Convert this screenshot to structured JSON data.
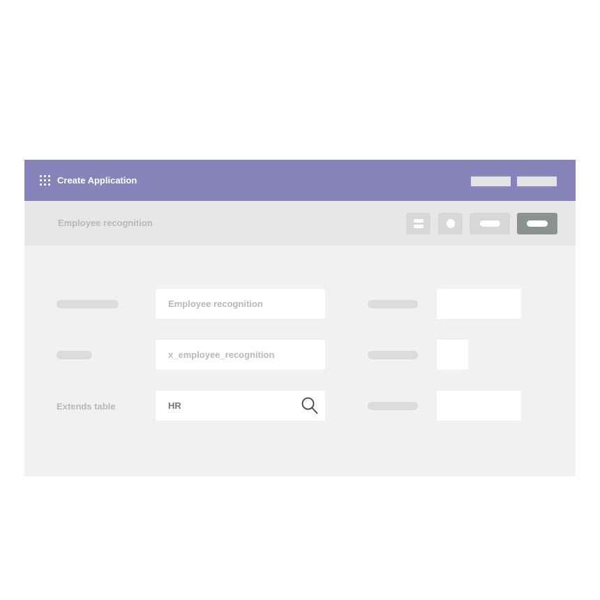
{
  "header": {
    "app_icon": "grid-icon",
    "title": "Create Application"
  },
  "toolbar": {
    "form_name": "Employee recognition",
    "icons": [
      "list-icon",
      "circle-icon",
      "pill-icon",
      "pill-icon"
    ]
  },
  "form": {
    "fields": [
      {
        "label": "",
        "value": "Employee recognition"
      },
      {
        "label": "",
        "value": "x_employee_recognition"
      },
      {
        "label": "Extends table",
        "value": "HR",
        "icon": "search-icon"
      }
    ]
  },
  "colors": {
    "header_bg": "#8884bb",
    "toolbar_bg": "#e6e7e6",
    "content_bg": "#f1f1f1",
    "primary_button": "#8b9391",
    "placeholder": "#dcdcdc"
  }
}
